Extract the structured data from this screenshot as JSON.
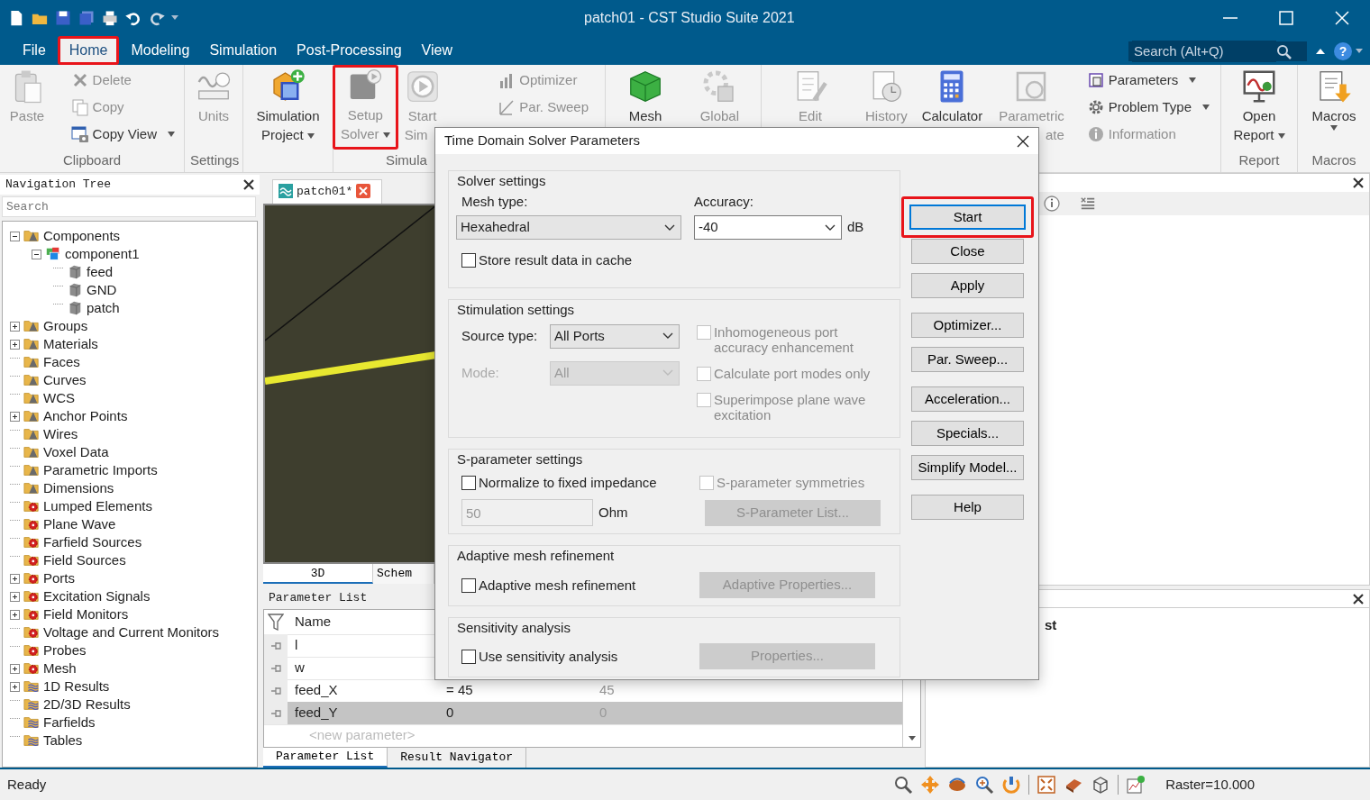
{
  "window": {
    "title": "patch01 - CST Studio Suite 2021"
  },
  "menu_tabs": [
    {
      "label": "File",
      "selected": false,
      "annotated": false
    },
    {
      "label": "Home",
      "selected": true,
      "annotated": true
    },
    {
      "label": "Modeling",
      "selected": false,
      "annotated": false
    },
    {
      "label": "Simulation",
      "selected": false,
      "annotated": false
    },
    {
      "label": "Post-Processing",
      "selected": false,
      "annotated": false
    },
    {
      "label": "View",
      "selected": false,
      "annotated": false
    }
  ],
  "search": {
    "placeholder": "Search (Alt+Q)"
  },
  "help_glyph": "?",
  "ribbon": {
    "groups": [
      {
        "label": "Clipboard",
        "items": [
          {
            "kind": "large",
            "lines": [
              "Paste"
            ],
            "disabled": true,
            "dropdown": false,
            "annotated": false
          },
          {
            "kind": "stack",
            "items": [
              {
                "label": "Delete",
                "disabled": true,
                "dropdown": false
              },
              {
                "label": "Copy",
                "disabled": true,
                "dropdown": false
              },
              {
                "label": "Copy View",
                "disabled": false,
                "dropdown": true
              }
            ]
          }
        ]
      },
      {
        "label": "Settings",
        "items": [
          {
            "kind": "large",
            "lines": [
              "Units"
            ],
            "disabled": true,
            "dropdown": false,
            "annotated": false
          }
        ]
      },
      {
        "items": [
          {
            "kind": "large",
            "lines": [
              "Simulation",
              "Project"
            ],
            "disabled": false,
            "dropdown": true,
            "annotated": false
          }
        ]
      },
      {
        "label": "Simula",
        "items": [
          {
            "kind": "large",
            "lines": [
              "Setup",
              "Solver"
            ],
            "disabled": true,
            "dropdown": true,
            "annotated": true
          },
          {
            "kind": "large",
            "lines": [
              "Start",
              "Sim"
            ],
            "disabled": true,
            "dropdown": false,
            "annotated": false
          },
          {
            "kind": "stack",
            "items": [
              {
                "label": "Optimizer",
                "disabled": true,
                "dropdown": false
              },
              {
                "label": "Par. Sweep",
                "disabled": true,
                "dropdown": false
              }
            ]
          }
        ]
      },
      {
        "items": [
          {
            "kind": "large",
            "lines": [
              "Mesh"
            ],
            "disabled": false,
            "dropdown": false,
            "annotated": false
          },
          {
            "kind": "large",
            "lines": [
              "Global"
            ],
            "disabled": true,
            "dropdown": false,
            "annotated": false
          }
        ]
      },
      {
        "items": [
          {
            "kind": "large",
            "lines": [
              "Edit"
            ],
            "disabled": true,
            "dropdown": false,
            "annotated": false
          },
          {
            "kind": "large",
            "lines": [
              "History"
            ],
            "disabled": true,
            "dropdown": false,
            "annotated": false
          },
          {
            "kind": "large",
            "lines": [
              "Calculator"
            ],
            "disabled": false,
            "dropdown": false,
            "annotated": false
          },
          {
            "kind": "large",
            "lines": [
              "Parametric",
              "ate"
            ],
            "disabled": true,
            "dropdown": false,
            "annotated": false
          },
          {
            "kind": "stack",
            "items": [
              {
                "label": "Parameters",
                "disabled": false,
                "dropdown": true
              },
              {
                "label": "Problem Type",
                "disabled": false,
                "dropdown": true
              },
              {
                "label": "Information",
                "disabled": true,
                "dropdown": false
              }
            ]
          }
        ]
      },
      {
        "label": "Report",
        "items": [
          {
            "kind": "large",
            "lines": [
              "Open",
              "Report"
            ],
            "disabled": false,
            "dropdown": true,
            "annotated": false
          }
        ]
      },
      {
        "label": "Macros",
        "items": [
          {
            "kind": "large",
            "lines": [
              "Macros"
            ],
            "disabled": false,
            "dropdown": true,
            "annotated": false
          }
        ]
      }
    ]
  },
  "navigation_tree": {
    "title": "Navigation Tree",
    "search": {
      "placeholder": "Search"
    },
    "items": [
      {
        "label": "Components",
        "kind": "folder",
        "expanded": true,
        "children": [
          {
            "label": "component1",
            "kind": "component",
            "expanded": true,
            "children": [
              {
                "label": "feed",
                "kind": "solid"
              },
              {
                "label": "GND",
                "kind": "solid"
              },
              {
                "label": "patch",
                "kind": "solid"
              }
            ]
          }
        ]
      },
      {
        "label": "Groups",
        "kind": "folder",
        "expanded": false
      },
      {
        "label": "Materials",
        "kind": "folder",
        "expanded": false
      },
      {
        "label": "Faces",
        "kind": "folder"
      },
      {
        "label": "Curves",
        "kind": "folder"
      },
      {
        "label": "WCS",
        "kind": "folder"
      },
      {
        "label": "Anchor Points",
        "kind": "folder",
        "expanded": false
      },
      {
        "label": "Wires",
        "kind": "folder"
      },
      {
        "label": "Voxel Data",
        "kind": "folder"
      },
      {
        "label": "Parametric Imports",
        "kind": "folder"
      },
      {
        "label": "Dimensions",
        "kind": "folder"
      },
      {
        "label": "Lumped Elements",
        "kind": "source"
      },
      {
        "label": "Plane Wave",
        "kind": "source"
      },
      {
        "label": "Farfield Sources",
        "kind": "source"
      },
      {
        "label": "Field Sources",
        "kind": "source"
      },
      {
        "label": "Ports",
        "kind": "source",
        "expanded": false
      },
      {
        "label": "Excitation Signals",
        "kind": "source",
        "expanded": false
      },
      {
        "label": "Field Monitors",
        "kind": "source",
        "expanded": false
      },
      {
        "label": "Voltage and Current Monitors",
        "kind": "source"
      },
      {
        "label": "Probes",
        "kind": "source"
      },
      {
        "label": "Mesh",
        "kind": "source",
        "expanded": false
      },
      {
        "label": "1D Results",
        "kind": "result",
        "expanded": false
      },
      {
        "label": "2D/3D Results",
        "kind": "result"
      },
      {
        "label": "Farfields",
        "kind": "result"
      },
      {
        "label": "Tables",
        "kind": "result"
      }
    ]
  },
  "document_tab": {
    "label": "patch01*"
  },
  "view_tabs": [
    {
      "label": "3D",
      "selected": true
    },
    {
      "label": "Schem",
      "selected": false
    }
  ],
  "parameter_list": {
    "title": "Parameter List",
    "columns": [
      "Name"
    ],
    "rows": [
      {
        "name": "l",
        "selected": false
      },
      {
        "name": "w",
        "selected": false
      },
      {
        "name": "feed_X",
        "expression": "= 45",
        "value": "45",
        "selected": false
      },
      {
        "name": "feed_Y",
        "expression": "0",
        "value": "0",
        "selected": true
      }
    ],
    "new_row_placeholder": "<new parameter>"
  },
  "bottom_tabs": [
    {
      "label": "Parameter List",
      "selected": true
    },
    {
      "label": "Result Navigator",
      "selected": false
    }
  ],
  "right_panel": {
    "lower_text": "st"
  },
  "dialog": {
    "title": "Time Domain Solver Parameters",
    "solver_settings": {
      "legend": "Solver settings",
      "mesh_type": {
        "label": "Mesh type:",
        "value": "Hexahedral"
      },
      "accuracy": {
        "label": "Accuracy:",
        "value": "-40",
        "unit": "dB"
      },
      "store_cache": {
        "label": "Store result data in cache",
        "checked": false
      }
    },
    "stimulation_settings": {
      "legend": "Stimulation settings",
      "source_type": {
        "label": "Source type:",
        "value": "All Ports",
        "disabled": false
      },
      "mode": {
        "label": "Mode:",
        "value": "All",
        "disabled": true
      },
      "options": [
        {
          "label": "Inhomogeneous port accuracy enhancement",
          "checked": false,
          "disabled": true
        },
        {
          "label": "Calculate port modes only",
          "checked": false,
          "disabled": true
        },
        {
          "label": "Superimpose plane wave excitation",
          "checked": false,
          "disabled": true
        }
      ]
    },
    "sparameter_settings": {
      "legend": "S-parameter settings",
      "normalize": {
        "label": "Normalize to fixed impedance",
        "checked": false
      },
      "impedance": {
        "value": "50",
        "unit": "Ohm",
        "disabled": true
      },
      "symmetries": {
        "label": "S-parameter symmetries",
        "checked": false,
        "disabled": true
      },
      "list_button": {
        "label": "S-Parameter List...",
        "disabled": true
      }
    },
    "adaptive": {
      "legend": "Adaptive mesh refinement",
      "checkbox": {
        "label": "Adaptive mesh refinement",
        "checked": false
      },
      "button": {
        "label": "Adaptive Properties...",
        "disabled": true
      }
    },
    "sensitivity": {
      "legend": "Sensitivity analysis",
      "checkbox": {
        "label": "Use sensitivity analysis",
        "checked": false
      },
      "button": {
        "label": "Properties...",
        "disabled": true
      }
    },
    "button_groups": [
      [
        {
          "label": "Start",
          "focused": true,
          "annotated": true
        },
        {
          "label": "Close",
          "focused": false,
          "annotated": false
        },
        {
          "label": "Apply",
          "focused": false,
          "annotated": false
        }
      ],
      [
        {
          "label": "Optimizer...",
          "focused": false,
          "annotated": false
        },
        {
          "label": "Par. Sweep...",
          "focused": false,
          "annotated": false
        }
      ],
      [
        {
          "label": "Acceleration...",
          "focused": false,
          "annotated": false
        },
        {
          "label": "Specials...",
          "focused": false,
          "annotated": false
        },
        {
          "label": "Simplify Model...",
          "focused": false,
          "annotated": false
        }
      ],
      [
        {
          "label": "Help",
          "focused": false,
          "annotated": false
        }
      ]
    ]
  },
  "status_bar": {
    "message": "Ready",
    "raster": "Raster=10.000"
  }
}
